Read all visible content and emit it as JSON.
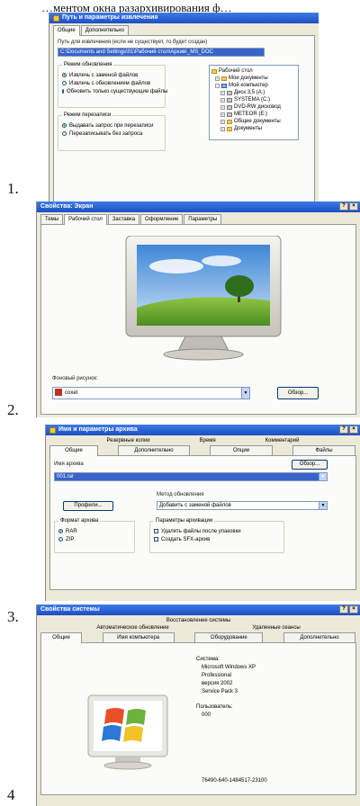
{
  "caption": "…ментом окна разархивирования ф…",
  "numbers": [
    "1.",
    "2.",
    "3.",
    "4"
  ],
  "win1": {
    "title": "Путь и параметры извлечения",
    "tabs": [
      "Общие",
      "Дополнительно"
    ],
    "path_label": "Путь для извлечения (если не существует, то будет создан)",
    "path_value": "C:\\Documents and Settings\\01\\Рабочий стол\\Архив\\_MS_DOC",
    "update_group": "Режим обновления",
    "update_options": [
      "Извлечь с заменой файлов",
      "Извлечь с обновлением файлов",
      "Обновить только существующие файлы"
    ],
    "overwrite_group": "Режим перезаписи",
    "overwrite_options": [
      "Выдавать запрос при перезаписи",
      "Перезаписывать без запроса"
    ],
    "tree": [
      {
        "label": "Рабочий стол",
        "icon": "folder-icon"
      },
      {
        "label": "Мои документы",
        "icon": "folder-icon"
      },
      {
        "label": "Мой компьютер",
        "icon": "computer-icon"
      },
      {
        "label": "Диск 3,5 (A:)",
        "icon": "drive-icon"
      },
      {
        "label": "SYSTEMA (C:)",
        "icon": "drive-icon"
      },
      {
        "label": "DVD-RW дисковод",
        "icon": "drive-icon"
      },
      {
        "label": "METEOR (E:)",
        "icon": "drive-icon"
      },
      {
        "label": "Общие документы",
        "icon": "folder-icon"
      },
      {
        "label": "Документы",
        "icon": "folder-icon"
      }
    ]
  },
  "win2": {
    "title": "Свойства: Экран",
    "tabs": [
      "Темы",
      "Рабочий стол",
      "Заставка",
      "Оформление",
      "Параметры"
    ],
    "bg_label": "Фоновый рисунок:",
    "bg_value": "coxet",
    "browse": "Обзор..."
  },
  "win3": {
    "title": "Имя и параметры архива",
    "tabs_row1": [
      "Резервные копии",
      "Время",
      "Комментарий"
    ],
    "tabs_row2": [
      "Общие",
      "Дополнительно",
      "Опции",
      "Файлы"
    ],
    "name_label": "Имя архива",
    "browse": "Обзор...",
    "name_value": "001.rar",
    "update_label": "Метод обновления",
    "profiles_btn": "Профили...",
    "update_value": "Добавить с заменой файлов",
    "format_group": "Формат архива",
    "formats": [
      "RAR",
      "ZIP"
    ],
    "options_group": "Параметры архивации",
    "options": [
      "Удалить файлы после упаковки",
      "Создать SFX-архив"
    ]
  },
  "win4": {
    "title": "Свойства системы",
    "tabs_row1": [
      "Восстановление системы"
    ],
    "tabs_row2": [
      "Автоматическое обновление",
      "Удаленные сеансы"
    ],
    "tabs_row3": [
      "Общие",
      "Имя компьютера",
      "Оборудование",
      "Дополнительно"
    ],
    "system_label": "Система:",
    "os": [
      "Microsoft Windows XP",
      "Professional",
      "версия 2002",
      "Service Pack 3"
    ],
    "user_label": "Пользователь:",
    "user": "000",
    "serial": "76490-640-1484517-23100"
  }
}
